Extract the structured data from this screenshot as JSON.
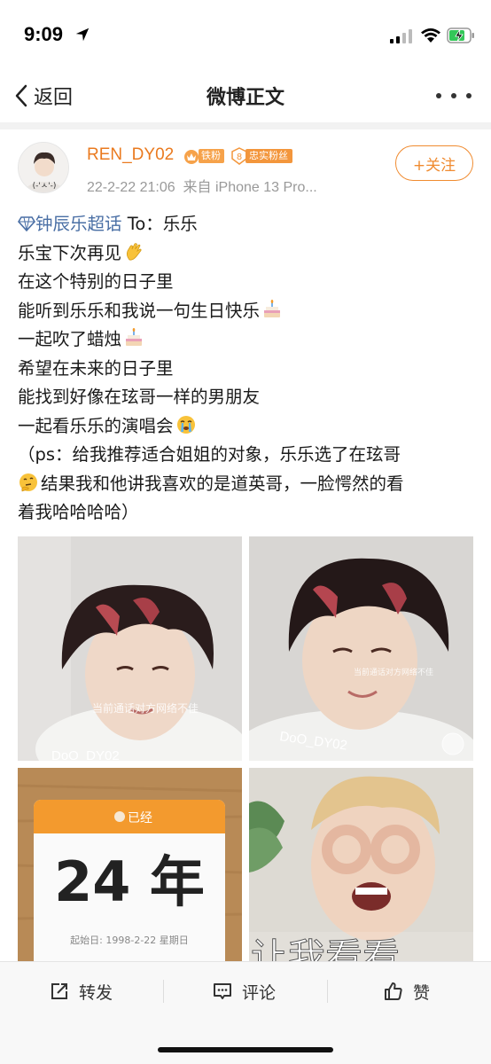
{
  "status_bar": {
    "time": "9:09"
  },
  "nav": {
    "back_label": "返回",
    "title": "微博正文"
  },
  "post": {
    "username": "REN_DY02",
    "badge_iron": "铁粉",
    "badge_fan_level": "8",
    "badge_fan": "忠实粉丝",
    "timestamp": "22-2-22 21:06",
    "source": "来自 iPhone 13 Pro...",
    "follow_label": "+关注",
    "topic": "钟辰乐超话",
    "lines": [
      "To：乐乐",
      "乐宝下次再见",
      "在这个特别的日子里",
      "能听到乐乐和我说一句生日快乐",
      "一起吹了蜡烛",
      "希望在未来的日子里",
      "能找到好像在玹哥一样的男朋友",
      "一起看乐乐的演唱会",
      "（ps：给我推荐适合姐姐的对象，乐乐选了在玹哥",
      "结果我和他讲我喜欢的是道英哥，一脸愕然的看",
      "着我哈哈哈哈）"
    ]
  },
  "images": {
    "img1_watermark": "DoO_DY02",
    "img1_overlay": "当前通话对方网络不佳",
    "img2_watermark": "DoO_DY02",
    "img2_overlay": "当前通话对方网络不佳",
    "calendar_header": "已经",
    "calendar_value": "24 年",
    "calendar_footer": "起始日: 1998-2-22 星期日",
    "img4_caption": "让我看看"
  },
  "actions": {
    "repost": "转发",
    "comment": "评论",
    "like": "赞"
  },
  "colors": {
    "accent": "#ea7a1f",
    "topic": "#4a6fa5",
    "follow": "#f08b30"
  },
  "icons": [
    "location-arrow-icon",
    "signal-icon",
    "wifi-icon",
    "battery-charging-icon",
    "chevron-left-icon",
    "more-dots-icon",
    "diamond-icon",
    "waving-hand-emoji",
    "birthday-cake-emoji",
    "crying-emoji",
    "thinking-emoji",
    "repost-icon",
    "comment-icon",
    "thumbs-up-icon"
  ]
}
